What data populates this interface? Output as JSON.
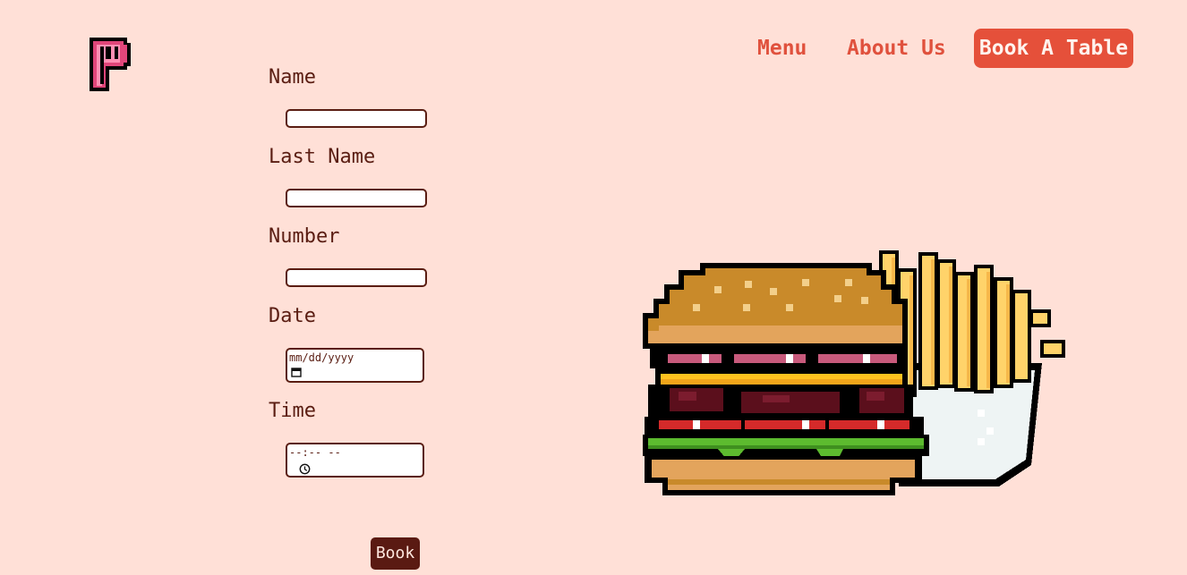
{
  "nav": {
    "menu": "Menu",
    "about": "About Us",
    "book_table": "Book A Table"
  },
  "form": {
    "name_label": "Name",
    "last_name_label": "Last Name",
    "number_label": "Number",
    "date_label": "Date",
    "date_placeholder": "mm/dd/yyyy",
    "time_label": "Time",
    "time_placeholder": "--:-- --",
    "submit_label": "Book"
  },
  "colors": {
    "background": "#ffe0d7",
    "accent": "#e5503a",
    "dark": "#5a1a12",
    "logo_pink": "#e0467a"
  },
  "icons": {
    "logo": "pixel-p-logo",
    "calendar": "calendar-icon",
    "clock": "clock-icon",
    "illustration": "burger-fries-pixel-art"
  }
}
